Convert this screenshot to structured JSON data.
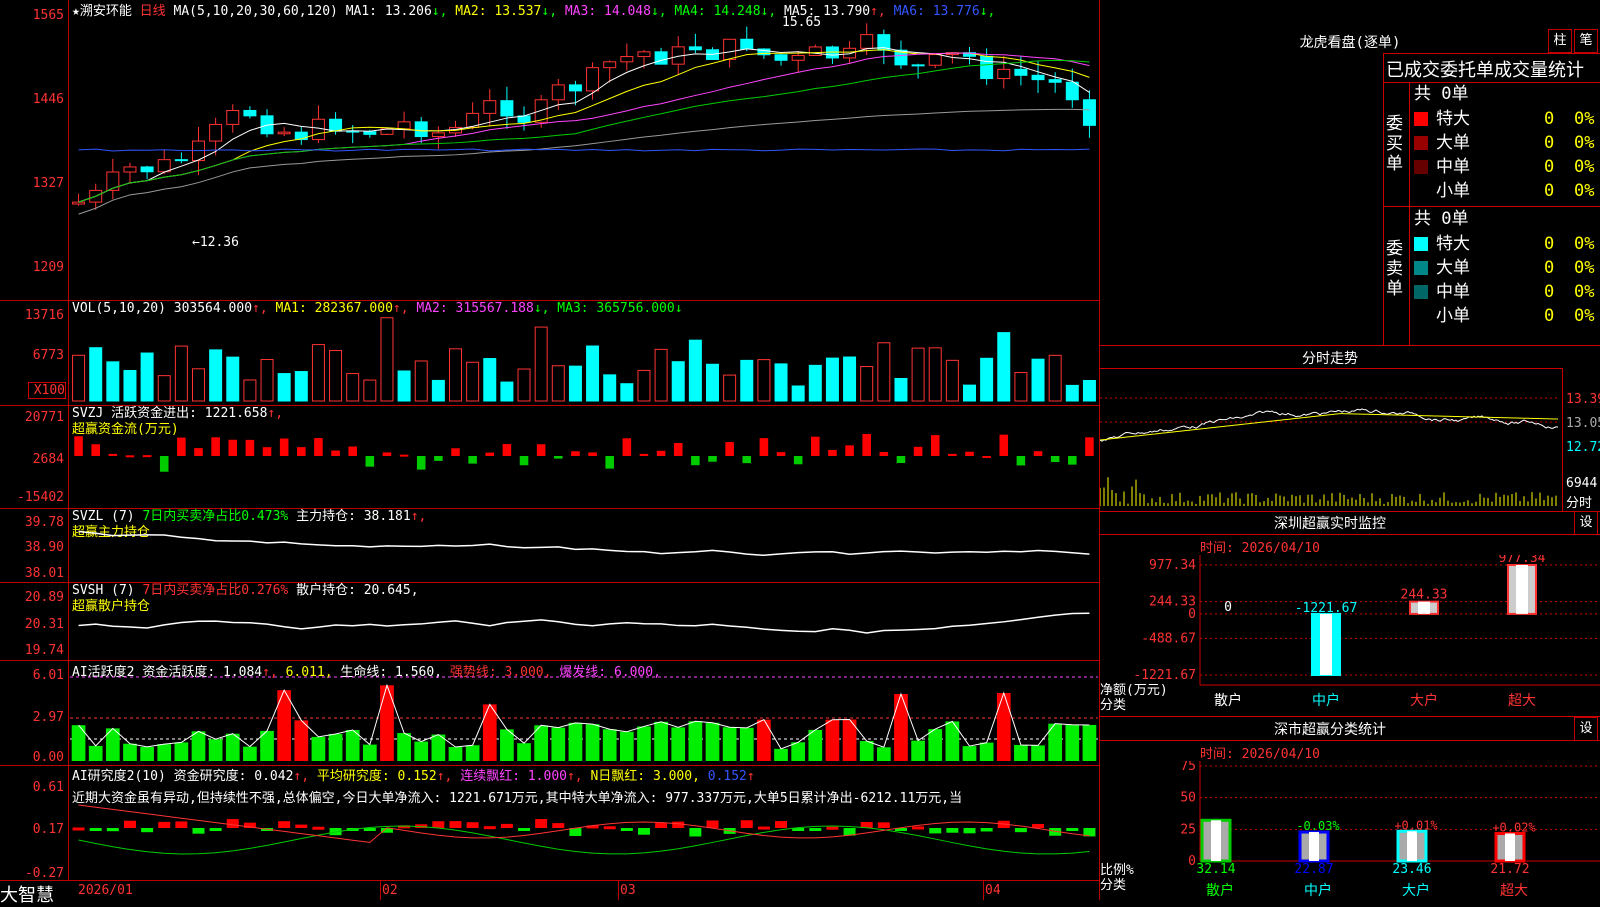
{
  "stock": {
    "name": "★溯安环能",
    "period": "日线",
    "ma_title": "MA(5,10,20,30,60,120)",
    "ma": [
      {
        "label": "MA1: 13.206",
        "arrow": "↓",
        "color": "#ffffff"
      },
      {
        "label": "MA2: 13.537",
        "arrow": "↓",
        "color": "#ffff00"
      },
      {
        "label": "MA3: 14.048",
        "arrow": "↓",
        "color": "#ff44ff"
      },
      {
        "label": "MA4: 14.248",
        "arrow": "↓",
        "color": "#00ff00"
      },
      {
        "label": "MA5: 13.790",
        "arrow": "↑",
        "color": "#ffffff"
      },
      {
        "label": "MA6: 13.776",
        "arrow": "↓",
        "color": "#3355ff"
      }
    ],
    "high_mark": "15.65",
    "low_mark": "←12.36"
  },
  "price_axis": [
    "1565",
    "1446",
    "1327",
    "1209"
  ],
  "vol": {
    "title": "VOL(5,10,20)",
    "value": "303564.000",
    "ma1": "MA1: 282367.000",
    "ma2": "MA2: 315567.188",
    "ma3": "MA3: 365756.000",
    "axis": [
      "13716",
      "6773",
      "X100"
    ]
  },
  "svzj": {
    "title": "SVZJ",
    "label": "活跃资金进出: 1221.658",
    "sub": "超赢资金流(万元)",
    "axis": [
      "20771",
      "2684",
      "-15402"
    ]
  },
  "svzl": {
    "title": "SVZL (7)",
    "ratio": "7日内买卖净占比0.473%",
    "hold": "主力持仓: 38.181",
    "sub": "超赢主力持仓",
    "axis": [
      "39.78",
      "38.90",
      "38.01"
    ]
  },
  "svsh": {
    "title": "SVSH (7)",
    "ratio": "7日内买卖净占比0.276%",
    "hold": "散户持仓: 20.645,",
    "sub": "超赢散户持仓",
    "axis": [
      "20.89",
      "20.31",
      "19.74"
    ]
  },
  "ai_active": {
    "title": "AI活跃度2",
    "deg": "资金活跃度: 1.084",
    "val2": "6.011,",
    "life": "生命线: 1.560,",
    "strong": "强势线: 3.000,",
    "burst": "爆发线: 6.000,",
    "axis": [
      "6.01",
      "2.97",
      "0.00"
    ]
  },
  "ai_research": {
    "title": "AI研究度2(10)",
    "deg": "资金研究度: 0.042",
    "avg": "平均研究度: 0.152",
    "cont": "连续飘红: 1.000",
    "nday": "N日飘红: 3.000,",
    "last": "0.152",
    "comment": "近期大资金虽有异动,但持续性不强,总体偏空,今日大单净流入: 1221.671万元,其中特大单净流入: 977.337万元,大单5日累计净出-6212.11万元,当",
    "axis": [
      "0.61",
      "0.17",
      "-0.27"
    ]
  },
  "xaxis": [
    "2026/01",
    "02",
    "03",
    "04"
  ],
  "brand": "大智慧",
  "dragon": {
    "title": "龙虎看盘(逐单)",
    "btn1": "柱",
    "btn2": "笔",
    "header": "已成交委托单成交量统计",
    "buy_label": "委买单",
    "sell_label": "委卖单",
    "buy_total": "共 0单",
    "sell_total": "共 0单",
    "buy_rows": [
      {
        "name": "特大",
        "n": "0",
        "p": "0%",
        "color": "#ff0000"
      },
      {
        "name": "大单",
        "n": "0",
        "p": "0%",
        "color": "#990000"
      },
      {
        "name": "中单",
        "n": "0",
        "p": "0%",
        "color": "#660000"
      },
      {
        "name": "小单",
        "n": "0",
        "p": "0%",
        "color": "#000000"
      }
    ],
    "sell_rows": [
      {
        "name": "特大",
        "n": "0",
        "p": "0%",
        "color": "#00ffff"
      },
      {
        "name": "大单",
        "n": "0",
        "p": "0%",
        "color": "#008888"
      },
      {
        "name": "中单",
        "n": "0",
        "p": "0%",
        "color": "#006666"
      },
      {
        "name": "小单",
        "n": "0",
        "p": "0%",
        "color": "#000000"
      }
    ]
  },
  "intraday": {
    "title": "分时走势",
    "axis": [
      "13.39",
      "13.05",
      "12.72",
      "6944",
      "分时"
    ]
  },
  "monitor": {
    "title": "深圳超赢实时监控",
    "btn": "设",
    "time": "时间: 2026/04/10",
    "axis": [
      "977.34",
      "244.33",
      "0",
      "-488.67",
      "-1221.67"
    ],
    "ylabel1": "净额(万元)",
    "ylabel2": "分类",
    "bars": [
      {
        "name": "散户",
        "value": 0,
        "label": "0"
      },
      {
        "name": "中户",
        "value": -1221.67,
        "label": "-1221.67"
      },
      {
        "name": "大户",
        "value": 244.33,
        "label": "244.33"
      },
      {
        "name": "超大",
        "value": 977.34,
        "label": "977.34"
      }
    ]
  },
  "classify": {
    "title": "深市超赢分类统计",
    "btn": "设",
    "time": "时间: 2026/04/10",
    "axis": [
      "75",
      "50",
      "25",
      "0"
    ],
    "ylabel1": "比例%",
    "ylabel2": "分类",
    "bars": [
      {
        "name": "散户",
        "value": 32.14,
        "label": "32.14",
        "change": ""
      },
      {
        "name": "中户",
        "value": 22.87,
        "label": "22.87",
        "change": "-0.03%"
      },
      {
        "name": "大户",
        "value": 23.46,
        "label": "23.46",
        "change": "+0.01%"
      },
      {
        "name": "超大",
        "value": 21.72,
        "label": "21.72",
        "change": "+0.02%"
      }
    ]
  }
}
